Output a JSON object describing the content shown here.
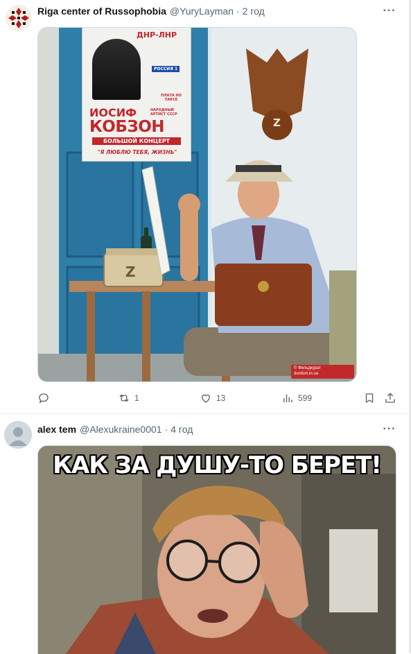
{
  "posts": [
    {
      "author_name": "Riga center of Russophobia",
      "handle": "@YuryLayman",
      "separator": "·",
      "time": "2 год",
      "more": "···",
      "poster": {
        "title_top": "ДНР-ЛНР",
        "name_first": "ИОСИФ",
        "name_last": "КОБЗОН",
        "artist_line": "НАРОДНЫЙ АРТИСТ СССР",
        "concert": "БОЛЬШОЙ КОНЦЕРТ",
        "song": "\"Я ЛЮБЛЮ ТЕБЯ, ЖИЗНЬ\"",
        "channel_1": "РОССИЯ 1",
        "price": "ПЛАТА НО ТАКСЕ"
      },
      "cassette_letter": "Z",
      "emblem_letter": "Z",
      "watermark_line1": "© Фельдкурат",
      "watermark_line2": "durdom.in.ua",
      "actions": {
        "reply_count": "",
        "repost_count": "1",
        "like_count": "13",
        "views_count": "599"
      }
    },
    {
      "author_name": "alex tem",
      "handle": "@Alexukraine0001",
      "separator": "·",
      "time": "4 год",
      "more": "···",
      "caption": "КАК ЗА ДУШУ-ТО БЕРЕТ!"
    }
  ],
  "colors": {
    "accent": "#1d9bf0",
    "text_secondary": "#536471",
    "divider": "#e6ecf0"
  }
}
